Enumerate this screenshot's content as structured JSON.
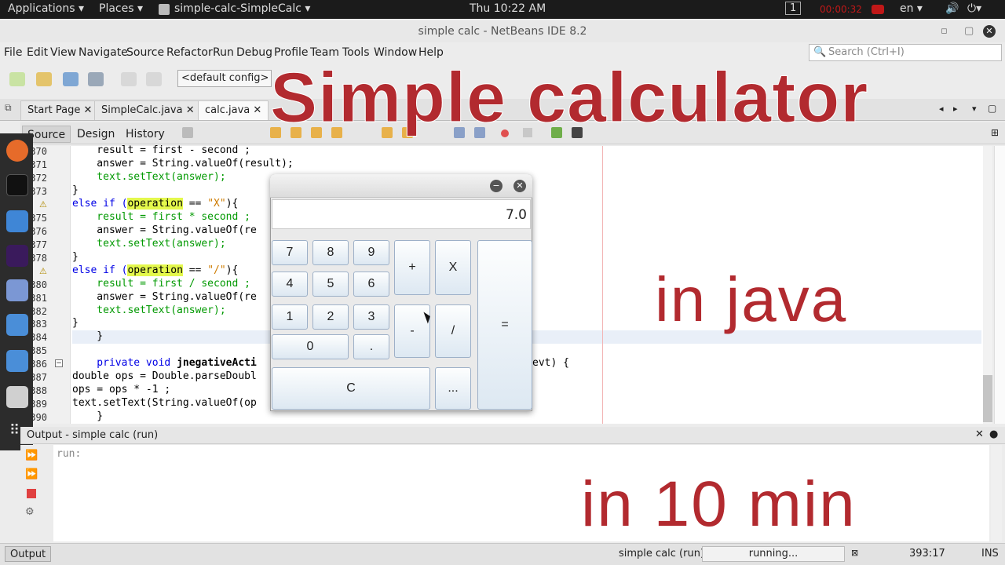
{
  "topbar": {
    "applications": "Applications ▾",
    "places": "Places ▾",
    "app_name": "simple-calc-SimpleCalc ▾",
    "clock": "Thu 10:22 AM",
    "workspace": "1",
    "timer": "00:00:32",
    "lang": "en ▾"
  },
  "window": {
    "title": "simple calc - NetBeans IDE 8.2"
  },
  "menu": [
    "File",
    "Edit",
    "View",
    "Navigate",
    "Source",
    "Refactor",
    "Run",
    "Debug",
    "Profile",
    "Team",
    "Tools",
    "Window",
    "Help"
  ],
  "search": {
    "placeholder": "Search (Ctrl+I)"
  },
  "toolbar": {
    "config": "<default config>"
  },
  "tabs": {
    "start": "Start Page",
    "simplecalc": "SimpleCalc.java",
    "calc": "calc.java"
  },
  "subtabs": {
    "source": "Source",
    "design": "Design",
    "history": "History"
  },
  "code": {
    "l370": "    result = first - second ;",
    "l371": "    answer = String.valueOf(result);",
    "l372": "    text.setText(answer);",
    "l373": "}",
    "l374a": "else if (",
    "l374op": "operation",
    "l374b": " == ",
    "l374s": "\"X\"",
    "l374c": "){",
    "l375": "    result = first * second ;",
    "l376": "    answer = String.valueOf(re",
    "l377": "    text.setText(answer);",
    "l378": "}",
    "l379a": "else if (",
    "l379op": "operation",
    "l379b": " == ",
    "l379s": "\"/\"",
    "l379c": "){",
    "l380": "    result = first / second ;",
    "l381": "    answer = String.valueOf(re",
    "l382": "    text.setText(answer);",
    "l383": "}",
    "l384": "    }",
    "l386a": "    private void ",
    "l386b": "jnegativeActi",
    "l386c": "evt) {",
    "l387": "double ops = Double.parseDoubl",
    "l388": "ops = ops * -1 ;",
    "l389": "text.setText(String.valueOf(op",
    "l390": "    }"
  },
  "line_numbers": [
    "370",
    "371",
    "372",
    "373",
    "",
    "375",
    "376",
    "377",
    "378",
    "",
    "380",
    "381",
    "382",
    "383",
    "384",
    "385",
    "386",
    "387",
    "388",
    "389",
    "390"
  ],
  "output": {
    "title_prefix": "Output - ",
    "title_bold": "simple calc (run)",
    "text": "run:"
  },
  "status": {
    "output_tab": "Output",
    "run": "simple calc (run)",
    "running": "running...",
    "pos": "393:17",
    "mode": "INS"
  },
  "calculator": {
    "display": "7.0",
    "keys": [
      "7",
      "8",
      "9",
      "+",
      "X",
      "4",
      "5",
      "6",
      "1",
      "2",
      "3",
      "-",
      "/",
      "=",
      "0",
      ".",
      "C",
      "..."
    ]
  },
  "captions": {
    "title": "Simple calculator",
    "java": "in java",
    "time": "in 10 min"
  }
}
